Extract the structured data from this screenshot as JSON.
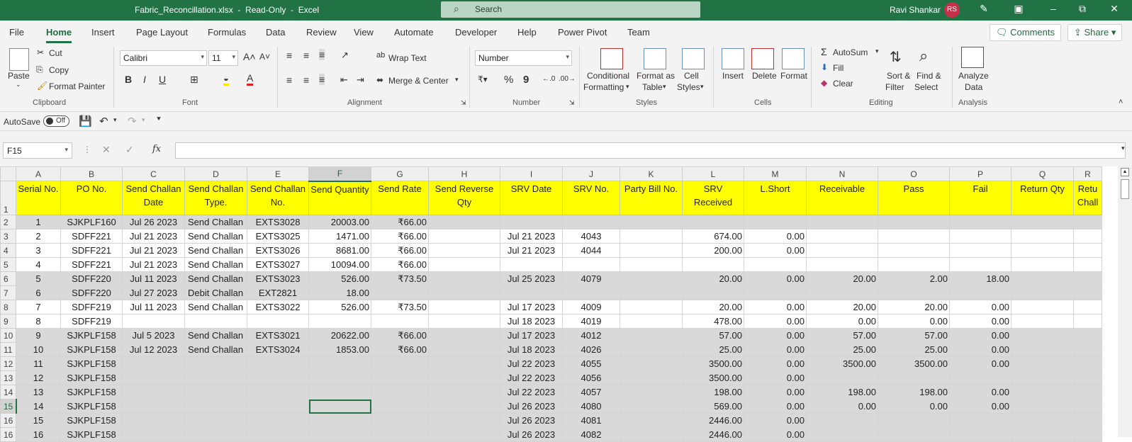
{
  "titlebar": {
    "title": "Fabric_Reconcillation.xlsx  -  Read-Only  -  Excel",
    "search_placeholder": "Search",
    "user_name": "Ravi Shankar",
    "user_initials": "RS"
  },
  "menu": {
    "tabs": [
      "File",
      "Home",
      "Insert",
      "Page Layout",
      "Formulas",
      "Data",
      "Review",
      "View",
      "Automate",
      "Developer",
      "Help",
      "Power Pivot",
      "Team"
    ],
    "active": "Home",
    "comments_label": "Comments",
    "share_label": "Share"
  },
  "ribbon": {
    "clipboard": {
      "paste": "Paste",
      "cut": "Cut",
      "copy": "Copy",
      "format_painter": "Format Painter",
      "group": "Clipboard"
    },
    "font": {
      "name": "Calibri",
      "size": "11",
      "group": "Font",
      "bold": "B",
      "italic": "I",
      "underline": "U"
    },
    "alignment": {
      "wrap_text": "Wrap Text",
      "merge_center": "Merge & Center",
      "group": "Alignment"
    },
    "number": {
      "format": "Number",
      "group": "Number",
      "percent": "%",
      "comma": "9"
    },
    "styles": {
      "conditional": "Conditional",
      "formatting": "Formatting",
      "format_as": "Format as",
      "table": "Table",
      "cell": "Cell",
      "cell_styles": "Styles",
      "group": "Styles"
    },
    "cells": {
      "insert": "Insert",
      "delete": "Delete",
      "format": "Format",
      "group": "Cells"
    },
    "editing": {
      "autosum": "AutoSum",
      "fill": "Fill",
      "clear": "Clear",
      "sort": "Sort &",
      "filter": "Filter",
      "find": "Find &",
      "select": "Select",
      "group": "Editing"
    },
    "analysis": {
      "analyze": "Analyze",
      "data": "Data",
      "group": "Analysis"
    }
  },
  "qat": {
    "autosave": "AutoSave",
    "autosave_state": "Off"
  },
  "formula_bar": {
    "name_box": "F15",
    "fx": "fx",
    "value": ""
  },
  "sheet": {
    "col_letters": [
      "A",
      "B",
      "C",
      "D",
      "E",
      "F",
      "G",
      "H",
      "I",
      "J",
      "K",
      "L",
      "M",
      "N",
      "O",
      "P",
      "Q",
      "R"
    ],
    "headers": [
      "Serial No.",
      "PO No.",
      "Send Challan Date",
      "Send Challan Type.",
      "Send Challan No.",
      "Send Quantity",
      "Send Rate",
      "Send Reverse Qty",
      "SRV Date",
      "SRV No.",
      "Party Bill No.",
      "SRV Received",
      "L.Short",
      "Receivable",
      "Pass",
      "Fail",
      "Return Qty",
      "Retu Chall"
    ],
    "rows": [
      {
        "n": "2",
        "grey": true,
        "cells": [
          "1",
          "SJKPLF160",
          "Jul 26 2023",
          "Send Challan",
          "EXTS3028",
          "20003.00",
          "₹66.00",
          "",
          "",
          "",
          "",
          "",
          "",
          "",
          "",
          "",
          "",
          ""
        ]
      },
      {
        "n": "3",
        "grey": false,
        "cells": [
          "2",
          "SDFF221",
          "Jul 21 2023",
          "Send Challan",
          "EXTS3025",
          "1471.00",
          "₹66.00",
          "",
          "Jul 21 2023",
          "4043",
          "",
          "674.00",
          "0.00",
          "",
          "",
          "",
          "",
          ""
        ]
      },
      {
        "n": "4",
        "grey": false,
        "cells": [
          "3",
          "SDFF221",
          "Jul 21 2023",
          "Send Challan",
          "EXTS3026",
          "8681.00",
          "₹66.00",
          "",
          "Jul 21 2023",
          "4044",
          "",
          "200.00",
          "0.00",
          "",
          "",
          "",
          "",
          ""
        ]
      },
      {
        "n": "5",
        "grey": false,
        "cells": [
          "4",
          "SDFF221",
          "Jul 21 2023",
          "Send Challan",
          "EXTS3027",
          "10094.00",
          "₹66.00",
          "",
          "",
          "",
          "",
          "",
          "",
          "",
          "",
          "",
          "",
          ""
        ]
      },
      {
        "n": "6",
        "grey": true,
        "cells": [
          "5",
          "SDFF220",
          "Jul 11 2023",
          "Send Challan",
          "EXTS3023",
          "526.00",
          "₹73.50",
          "",
          "Jul 25 2023",
          "4079",
          "",
          "20.00",
          "0.00",
          "20.00",
          "2.00",
          "18.00",
          "",
          ""
        ]
      },
      {
        "n": "7",
        "grey": true,
        "cells": [
          "6",
          "SDFF220",
          "Jul 27 2023",
          "Debit Challan",
          "EXT2821",
          "18.00",
          "",
          "",
          "",
          "",
          "",
          "",
          "",
          "",
          "",
          "",
          "",
          ""
        ]
      },
      {
        "n": "8",
        "grey": false,
        "cells": [
          "7",
          "SDFF219",
          "Jul 11 2023",
          "Send Challan",
          "EXTS3022",
          "526.00",
          "₹73.50",
          "",
          "Jul 17 2023",
          "4009",
          "",
          "20.00",
          "0.00",
          "20.00",
          "20.00",
          "0.00",
          "",
          ""
        ]
      },
      {
        "n": "9",
        "grey": false,
        "cells": [
          "8",
          "SDFF219",
          "",
          "",
          "",
          "",
          "",
          "",
          "Jul 18 2023",
          "4019",
          "",
          "478.00",
          "0.00",
          "0.00",
          "0.00",
          "0.00",
          "",
          ""
        ]
      },
      {
        "n": "10",
        "grey": true,
        "cells": [
          "9",
          "SJKPLF158",
          "Jul  5 2023",
          "Send Challan",
          "EXTS3021",
          "20622.00",
          "₹66.00",
          "",
          "Jul 17 2023",
          "4012",
          "",
          "57.00",
          "0.00",
          "57.00",
          "57.00",
          "0.00",
          "",
          ""
        ]
      },
      {
        "n": "11",
        "grey": true,
        "cells": [
          "10",
          "SJKPLF158",
          "Jul 12 2023",
          "Send Challan",
          "EXTS3024",
          "1853.00",
          "₹66.00",
          "",
          "Jul 18 2023",
          "4026",
          "",
          "25.00",
          "0.00",
          "25.00",
          "25.00",
          "0.00",
          "",
          ""
        ]
      },
      {
        "n": "12",
        "grey": true,
        "cells": [
          "11",
          "SJKPLF158",
          "",
          "",
          "",
          "",
          "",
          "",
          "Jul 22 2023",
          "4055",
          "",
          "3500.00",
          "0.00",
          "3500.00",
          "3500.00",
          "0.00",
          "",
          ""
        ]
      },
      {
        "n": "13",
        "grey": true,
        "cells": [
          "12",
          "SJKPLF158",
          "",
          "",
          "",
          "",
          "",
          "",
          "Jul 22 2023",
          "4056",
          "",
          "3500.00",
          "0.00",
          "",
          "",
          "",
          "",
          ""
        ]
      },
      {
        "n": "14",
        "grey": true,
        "cells": [
          "13",
          "SJKPLF158",
          "",
          "",
          "",
          "",
          "",
          "",
          "Jul 22 2023",
          "4057",
          "",
          "198.00",
          "0.00",
          "198.00",
          "198.00",
          "0.00",
          "",
          ""
        ]
      },
      {
        "n": "15",
        "grey": true,
        "cells": [
          "14",
          "SJKPLF158",
          "",
          "",
          "",
          "",
          "",
          "",
          "Jul 26 2023",
          "4080",
          "",
          "569.00",
          "0.00",
          "0.00",
          "0.00",
          "0.00",
          "",
          ""
        ]
      },
      {
        "n": "16",
        "grey": true,
        "cells": [
          "15",
          "SJKPLF158",
          "",
          "",
          "",
          "",
          "",
          "",
          "Jul 26 2023",
          "4081",
          "",
          "2446.00",
          "0.00",
          "",
          "",
          "",
          "",
          ""
        ]
      },
      {
        "n": "16",
        "grey": true,
        "cells": [
          "16",
          "SJKPLF158",
          "",
          "",
          "",
          "",
          "",
          "",
          "Jul 26 2023",
          "4082",
          "",
          "2446.00",
          "0.00",
          "",
          "",
          "",
          "",
          ""
        ]
      }
    ],
    "selected_col": "F",
    "selected_row": "15",
    "colors": {
      "header_fill": "#ffff00",
      "grey_fill": "#d9d9d9",
      "accent": "#217346"
    }
  }
}
